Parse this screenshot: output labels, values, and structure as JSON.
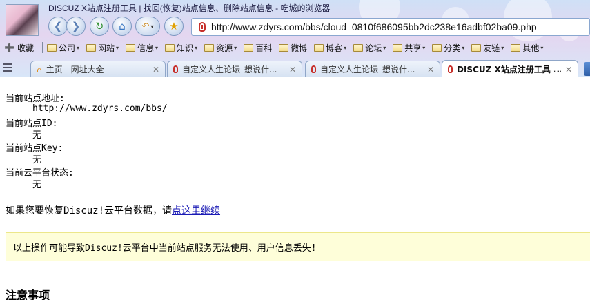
{
  "window": {
    "title": "DISCUZ X站点注册工具 | 找回(恢复)站点信息、删除站点信息 - 吃城的浏览器"
  },
  "toolbar": {
    "back_icon": "back-arrow-icon",
    "forward_icon": "forward-arrow-icon",
    "refresh_icon": "refresh-icon",
    "home_icon": "home-icon",
    "undo_icon": "undo-icon",
    "favorite_icon": "star-icon"
  },
  "address": {
    "url": "http://www.zdyrs.com/bbs/cloud_0810f686095bb2dc238e16adbf02ba09.php"
  },
  "bookmarks": {
    "favorites_label": "收藏",
    "items": [
      {
        "label": "公司"
      },
      {
        "label": "网站"
      },
      {
        "label": "信息"
      },
      {
        "label": "知识"
      },
      {
        "label": "资源"
      },
      {
        "label": "百科"
      },
      {
        "label": "微博"
      },
      {
        "label": "博客"
      },
      {
        "label": "论坛"
      },
      {
        "label": "共享"
      },
      {
        "label": "分类"
      },
      {
        "label": "友链"
      },
      {
        "label": "其他"
      }
    ]
  },
  "tabs": [
    {
      "label": "主页 - 网址大全"
    },
    {
      "label": "自定义人生论坛_想说什..."
    },
    {
      "label": "自定义人生论坛_想说什..."
    },
    {
      "label": "DISCUZ X站点注册工具 ..."
    }
  ],
  "page": {
    "site_url_label": "当前站点地址:",
    "site_url_value": "http://www.zdyrs.com/bbs/",
    "site_id_label": "当前站点ID:",
    "site_id_value": "无",
    "site_key_label": "当前站点Key:",
    "site_key_value": "无",
    "cloud_status_label": "当前云平台状态:",
    "cloud_status_value": "无",
    "restore_prefix": "如果您要恢复Discuz!云平台数据，请",
    "restore_link": "点这里继续",
    "warning": "以上操作可能导致Discuz!云平台中当前站点服务无法使用、用户信息丢失!",
    "notes_heading": "注意事项"
  },
  "colors": {
    "link": "#1a1ab5",
    "warning_bg": "#fefed9",
    "warning_border": "#ece78a"
  }
}
